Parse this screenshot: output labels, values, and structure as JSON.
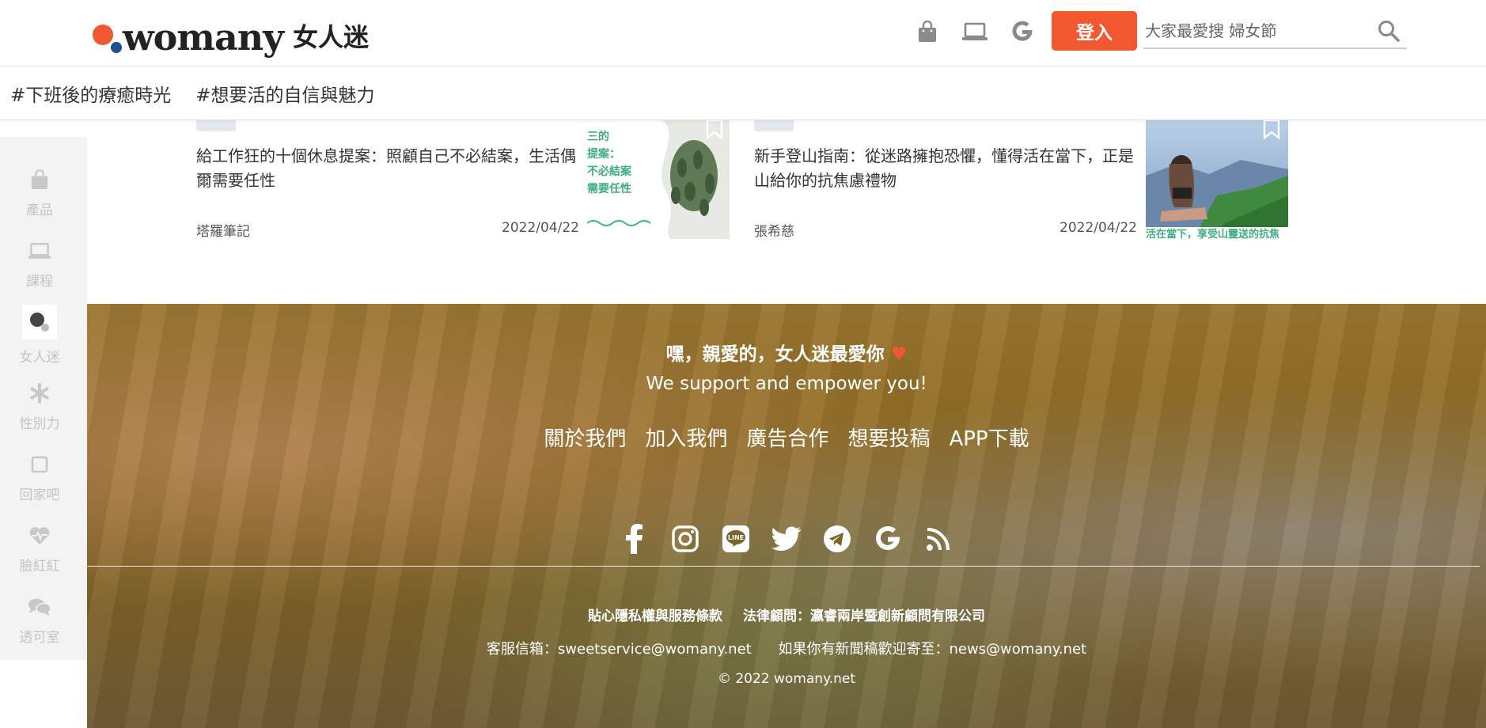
{
  "header": {
    "logo_word": "womany",
    "logo_cn": "女人迷",
    "login_label": "登入",
    "search_placeholder": "大家最愛搜 婦女節",
    "icons": [
      "bag-icon",
      "laptop-icon",
      "google-icon",
      "search-icon"
    ],
    "accent_color": "#f1582f"
  },
  "hashtags": [
    "#下班後的療癒時光",
    "#想要活的自信與魅力"
  ],
  "sidebar": {
    "items": [
      {
        "label": "產品",
        "icon": "bag-icon"
      },
      {
        "label": "課程",
        "icon": "laptop-icon"
      },
      {
        "label": "女人迷",
        "icon": "womany-logo-icon"
      },
      {
        "label": "性別力",
        "icon": "asterisk-icon"
      },
      {
        "label": "回家吧",
        "icon": "square-icon"
      },
      {
        "label": "臉紅紅",
        "icon": "heartbeat-icon"
      },
      {
        "label": "透可室",
        "icon": "chat-bubbles-icon"
      }
    ]
  },
  "articles": [
    {
      "title": "給工作狂的十個休息提案：照顧自己不必結案，生活偶爾需要任性",
      "author": "塔羅筆記",
      "date": "2022/04/22",
      "thumb_text": [
        "三的",
        "提案：",
        "不必結案",
        "需要任性"
      ]
    },
    {
      "title": "新手登山指南：從迷路擁抱恐懼，懂得活在當下，正是山給你的抗焦慮禮物",
      "author": "張希慈",
      "date": "2022/04/22",
      "thumb_text": [
        "活在當下，享受山靈送的抗焦"
      ]
    }
  ],
  "footer": {
    "love_text": "嘿，親愛的，女人迷最愛你",
    "heart": "♥",
    "slogan": "We support and empower you!",
    "links": [
      "關於我們",
      "加入我們",
      "廣告合作",
      "想要投稿",
      "APP下載"
    ],
    "social": [
      "facebook-icon",
      "instagram-icon",
      "line-icon",
      "twitter-icon",
      "telegram-icon",
      "google-icon",
      "rss-icon"
    ],
    "legal": [
      "貼心隱私權與服務條款",
      "法律顧問：瀛睿兩岸暨創新顧問有限公司"
    ],
    "contact": [
      "客服信箱：sweetservice@womany.net",
      "如果你有新聞稿歡迎寄至：news@womany.net"
    ],
    "copyright": "© 2022 womany.net"
  }
}
